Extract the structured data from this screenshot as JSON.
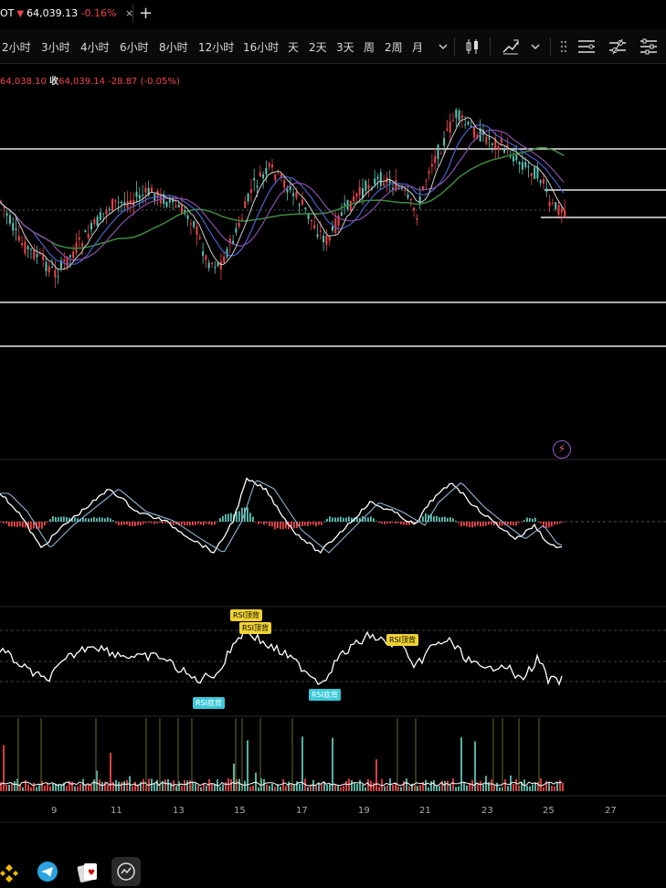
{
  "header": {
    "symbol_suffix": "OT",
    "price": "64,039.13",
    "change": "-0.16%",
    "close_symbol": "×",
    "add_symbol": "+"
  },
  "timeframes": [
    "2小时",
    "3小时",
    "4小时",
    "6小时",
    "8小时",
    "12小时",
    "16小时",
    "天",
    "2天",
    "3天",
    "周",
    "2周",
    "月"
  ],
  "toolbar_icons": [
    "chevron-down-icon",
    "candle-style-icon",
    "indicators-icon",
    "chevron-down-icon",
    "drag-handle-icon",
    "layout-icon",
    "drawing-icon",
    "settings-icon"
  ],
  "ohlc": {
    "open_partial": "64,038.10",
    "close_label": "收",
    "close_value": "64,039.14",
    "change": "-28.87",
    "change_pct": "(-0.05%)"
  },
  "rsi_badges": [
    {
      "text": "RSI顶背",
      "type": "top"
    },
    {
      "text": "RSI顶背",
      "type": "top"
    },
    {
      "text": "RSI顶背",
      "type": "top"
    },
    {
      "text": "RSI底背",
      "type": "bottom"
    },
    {
      "text": "RSI底背",
      "type": "bottom"
    }
  ],
  "x_axis": [
    "9",
    "11",
    "13",
    "15",
    "17",
    "19",
    "21",
    "23",
    "25",
    "27"
  ],
  "dock": [
    "binance-icon",
    "telegram-icon",
    "cards-app-icon",
    "chart-app-icon"
  ],
  "colors": {
    "up": "#5ec4b5",
    "down": "#ef454a",
    "ma_long": "#3d8b3d",
    "ma_blue": "#4a62c9",
    "ma_purple": "#8a4fa8",
    "rsi_badge_top": "#f0d233",
    "rsi_badge_bottom": "#3cc8d8"
  }
}
